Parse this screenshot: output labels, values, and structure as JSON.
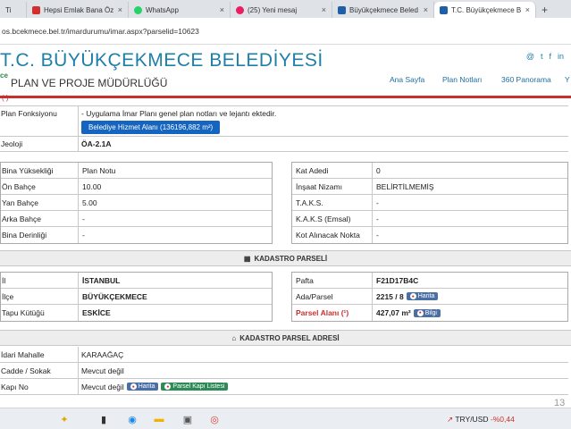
{
  "browser": {
    "tabs": [
      {
        "label": "Ti"
      },
      {
        "label": "Hepsi Emlak Bana Öz"
      },
      {
        "label": "WhatsApp"
      },
      {
        "label": "(25) Yeni mesaj"
      },
      {
        "label": "Büyükçekmece Beled"
      },
      {
        "label": "T.C. Büyükçekmece B",
        "active": true
      }
    ],
    "url": "os.bcekmece.bel.tr/imardurumu/imar.aspx?parselid=10623"
  },
  "header": {
    "title": "T.C. BÜYÜKÇEKMECE BELEDİYESİ",
    "subtitle": "PLAN VE PROJE MÜDÜRLÜĞÜ",
    "logo_text": "ce",
    "nav": [
      "Ana Sayfa",
      "Plan Notları",
      "360 Panorama",
      "Y"
    ],
    "social": [
      "@",
      "t",
      "f",
      "in"
    ]
  },
  "fragment": "( )",
  "plan": {
    "func_label": "Plan Fonksiyonu",
    "func_text": "- Uygulama İmar Planı genel plan notları ve lejantı ektedir.",
    "func_button": "Belediye Hizmet Alanı (136196,882 m²)",
    "geo_label": "Jeoloji",
    "geo_value": "ÖA-2.1A"
  },
  "left_table": [
    {
      "label": "Bina Yüksekliği",
      "value": "Plan Notu"
    },
    {
      "label": "Ön Bahçe",
      "value": "10.00"
    },
    {
      "label": "Yan Bahçe",
      "value": "5.00"
    },
    {
      "label": "Arka Bahçe",
      "value": "-"
    },
    {
      "label": "Bina Derinliği",
      "value": "-"
    }
  ],
  "right_table": [
    {
      "label": "Kat Adedi",
      "value": "0"
    },
    {
      "label": "İnşaat Nizamı",
      "value": "BELİRTİLMEMİŞ"
    },
    {
      "label": "T.A.K.S.",
      "value": "-"
    },
    {
      "label": "K.A.K.S (Emsal)",
      "value": "-"
    },
    {
      "label": "Kot Alınacak Nokta",
      "value": "-"
    }
  ],
  "kadastro": {
    "title": "KADASTRO PARSELİ",
    "left": [
      {
        "label": "İl",
        "value": "İSTANBUL"
      },
      {
        "label": "İlçe",
        "value": "BÜYÜKÇEKMECE"
      },
      {
        "label": "Tapu Kütüğü",
        "value": "ESKİCE"
      }
    ],
    "right": [
      {
        "label": "Pafta",
        "value": "F21D17B4C"
      },
      {
        "label": "Ada/Parsel",
        "value": "2215 / 8",
        "button": "Harita"
      },
      {
        "label": "Parsel Alanı (¹)",
        "value": "427,07 m²",
        "button": "Bilgi"
      }
    ]
  },
  "adres": {
    "title": "KADASTRO PARSEL ADRESİ",
    "rows": [
      {
        "label": "İdari Mahalle",
        "value": "KARAAĞAÇ"
      },
      {
        "label": "Cadde / Sokak",
        "value": "Mevcut değil"
      },
      {
        "label": "Kapı No",
        "value": "Mevcut değil",
        "btn1": "Harita",
        "btn2": "Parsel Kapı Listesi"
      }
    ]
  },
  "taskbar": {
    "currency": "TRY/USD",
    "change": "-%0,44",
    "corner": "13"
  },
  "colors": {
    "brand": "#1e7fa8",
    "accent_red": "#c9302c",
    "button_blue": "#1565c0"
  }
}
